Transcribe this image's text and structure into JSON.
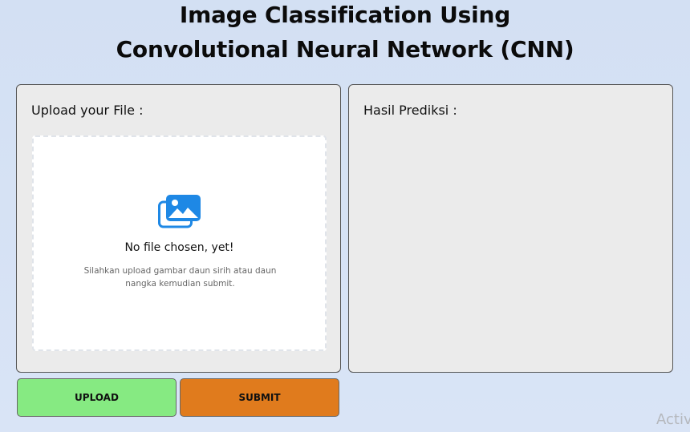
{
  "header": {
    "title_line1": "Image Classification Using",
    "title_line2": "Convolutional Neural Network (CNN)"
  },
  "upload_panel": {
    "label": "Upload your File :",
    "dropzone": {
      "icon": "images-icon",
      "title": "No file chosen, yet!",
      "description": "Silahkan upload gambar daun sirih atau daun nangka kemudian submit."
    }
  },
  "result_panel": {
    "label": "Hasil Prediksi :"
  },
  "buttons": {
    "upload_label": "UPLOAD",
    "submit_label": "SUBMIT"
  },
  "colors": {
    "upload_button": "#86ea82",
    "submit_button": "#e07b1d",
    "icon_blue": "#1e88e5",
    "panel_bg": "#ebebeb"
  },
  "watermark": "Activ"
}
